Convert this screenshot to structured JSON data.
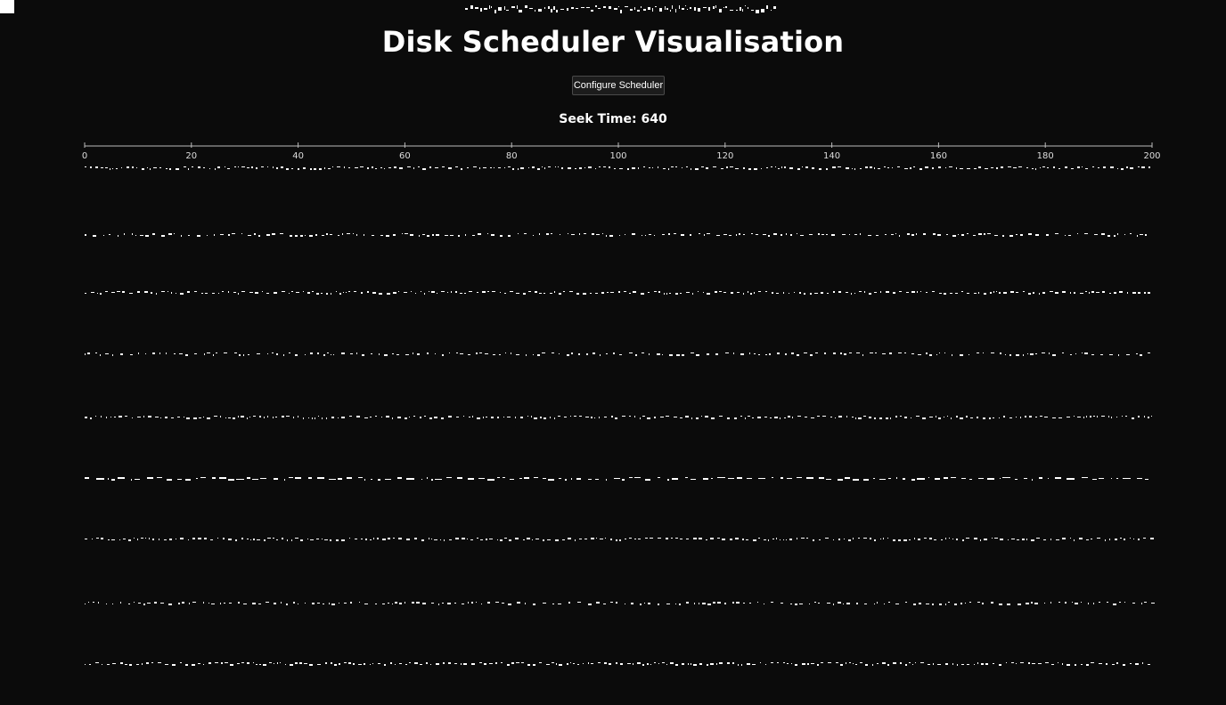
{
  "page": {
    "title": "Disk Scheduler Visualisation",
    "configure_label": "Configure Scheduler",
    "seek_label": "Seek Time:",
    "seek_value": "640"
  },
  "chart_data": {
    "type": "line",
    "title": "",
    "xlabel": "",
    "ylabel": "",
    "xlim": [
      0,
      200
    ],
    "x_ticks": [
      0,
      20,
      40,
      60,
      80,
      100,
      120,
      140,
      160,
      180,
      200
    ],
    "row_count": 9,
    "colors": {
      "background": "#0b0b0b",
      "axis": "#bbbbbb",
      "mark": "#ffffff",
      "button_bg": "#1c1c1c",
      "button_border": "#4a4a4a"
    }
  }
}
